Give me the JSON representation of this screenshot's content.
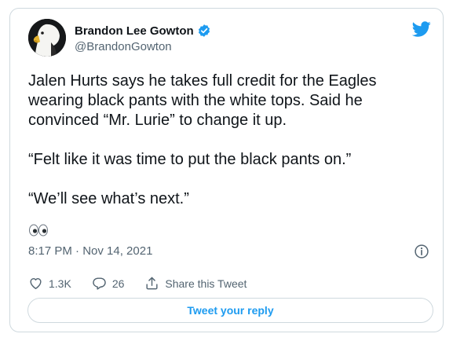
{
  "author": {
    "display_name": "Brandon Lee Gowton",
    "handle": "@BrandonGowton",
    "verified": true,
    "verified_icon": "verified-badge-icon",
    "avatar_icon": "eagle-head-avatar"
  },
  "brand_icon": "twitter-bird-icon",
  "tweet": {
    "paragraphs": [
      "Jalen Hurts says he takes full credit for the Eagles wearing black pants with the white tops. Said he convinced “Mr. Lurie” to change it up.",
      "“Felt like it was time to put the black pants on.”",
      "“We’ll see what’s next.”"
    ],
    "emoji": "eyes-emoji",
    "timestamp": "8:17 PM · Nov 14, 2021"
  },
  "actions": {
    "likes": "1.3K",
    "replies": "26",
    "share_label": "Share this Tweet"
  },
  "reply_button_label": "Tweet your reply",
  "colors": {
    "accent": "#1d9bf0",
    "text": "#0f1419",
    "secondary": "#536471",
    "border": "#cfd9de"
  }
}
